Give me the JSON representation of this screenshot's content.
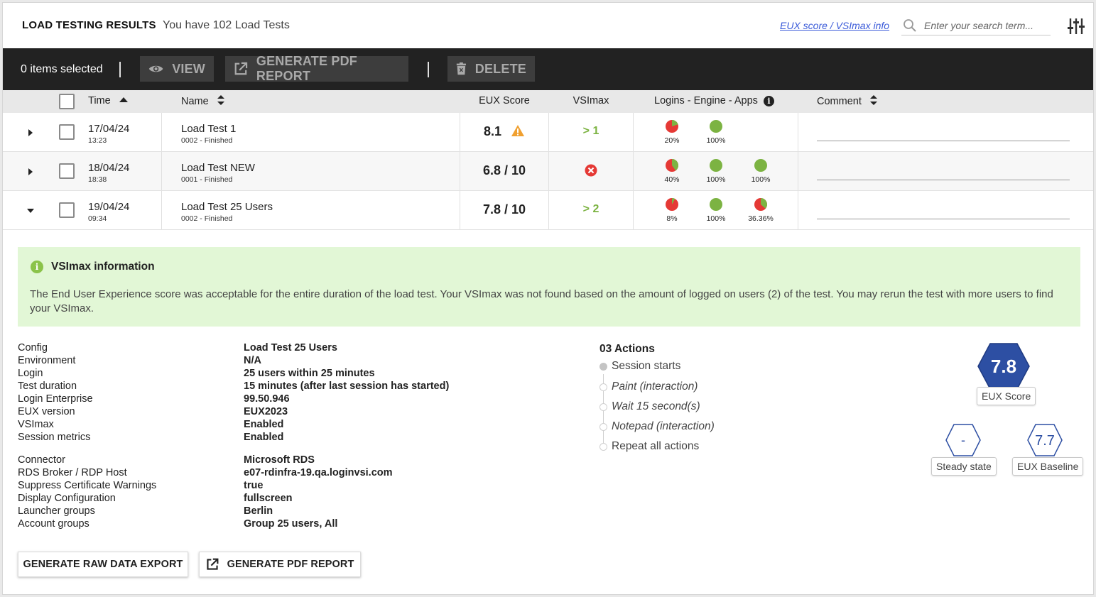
{
  "header": {
    "title": "LOAD TESTING RESULTS",
    "subtitle": "You have 102 Load Tests",
    "info_link": "EUX score / VSImax info",
    "search_placeholder": "Enter your search term..."
  },
  "toolbar": {
    "selected": "0 items selected",
    "view": "VIEW",
    "pdf": "GENERATE PDF REPORT",
    "delete": "DELETE"
  },
  "columns": {
    "time": "Time",
    "name": "Name",
    "eux": "EUX Score",
    "vsimax": "VSImax",
    "lea": "Logins - Engine - Apps",
    "comment": "Comment"
  },
  "rows": [
    {
      "date": "17/04/24",
      "time": "13:23",
      "name": "Load Test 1",
      "status": "0002 - Finished",
      "eux": "8.1",
      "eux_warning": true,
      "vsimax": "> 1",
      "vsimax_error": false,
      "expanded": false,
      "pies": [
        {
          "label": "20%",
          "fraction": 0.2
        },
        {
          "label": "100%",
          "fraction": 1.0
        }
      ]
    },
    {
      "date": "18/04/24",
      "time": "18:38",
      "name": "Load Test NEW",
      "status": "0001 - Finished",
      "eux": "6.8 / 10",
      "eux_warning": false,
      "vsimax": "",
      "vsimax_error": true,
      "expanded": false,
      "pies": [
        {
          "label": "40%",
          "fraction": 0.4
        },
        {
          "label": "100%",
          "fraction": 1.0
        },
        {
          "label": "100%",
          "fraction": 1.0
        }
      ]
    },
    {
      "date": "19/04/24",
      "time": "09:34",
      "name": "Load Test 25 Users",
      "status": "0002 - Finished",
      "eux": "7.8 / 10",
      "eux_warning": false,
      "vsimax": "> 2",
      "vsimax_error": false,
      "expanded": true,
      "pies": [
        {
          "label": "8%",
          "fraction": 0.08
        },
        {
          "label": "100%",
          "fraction": 1.0
        },
        {
          "label": "36.36%",
          "fraction": 0.3636
        }
      ]
    }
  ],
  "banner": {
    "title": "VSImax information",
    "text": "The End User Experience score was acceptable for the entire duration of the load test. Your VSImax was not found based on the amount of logged on users (2) of the test. You may rerun the test with more users to find your VSImax."
  },
  "details": {
    "group1": [
      {
        "key": "Config",
        "value": "Load Test 25 Users"
      },
      {
        "key": "Environment",
        "value": "N/A"
      },
      {
        "key": "Login",
        "value": "25 users within 25 minutes"
      },
      {
        "key": "Test duration",
        "value": "15 minutes (after last session has started)"
      },
      {
        "key": "Login Enterprise",
        "value": "99.50.946"
      },
      {
        "key": "EUX version",
        "value": "EUX2023"
      },
      {
        "key": "VSImax",
        "value": "Enabled"
      },
      {
        "key": "Session metrics",
        "value": "Enabled"
      }
    ],
    "group2": [
      {
        "key": "Connector",
        "value": "Microsoft RDS"
      },
      {
        "key": "RDS Broker / RDP Host",
        "value": "e07-rdinfra-19.qa.loginvsi.com"
      },
      {
        "key": "Suppress Certificate Warnings",
        "value": "true"
      },
      {
        "key": "Display Configuration",
        "value": "fullscreen"
      },
      {
        "key": "Launcher groups",
        "value": "Berlin"
      },
      {
        "key": "Account groups",
        "value": "Group 25 users, All"
      }
    ]
  },
  "actions": {
    "title": "03 Actions",
    "items": [
      {
        "label": "Session starts",
        "italic": false,
        "filled": true
      },
      {
        "label": "Paint (interaction)",
        "italic": true,
        "filled": false
      },
      {
        "label": "Wait 15 second(s)",
        "italic": true,
        "filled": false
      },
      {
        "label": "Notepad (interaction)",
        "italic": true,
        "filled": false
      },
      {
        "label": "Repeat all actions",
        "italic": false,
        "filled": false
      }
    ]
  },
  "scores": {
    "eux_value": "7.8",
    "eux_label": "EUX Score",
    "steady_value": "-",
    "steady_label": "Steady state",
    "baseline_value": "7.7",
    "baseline_label": "EUX Baseline"
  },
  "buttons": {
    "raw_export": "GENERATE RAW DATA EXPORT",
    "pdf_report": "GENERATE PDF REPORT"
  },
  "colors": {
    "accent_blue": "#2d4fa3",
    "green": "#7cb342",
    "red": "#e53935",
    "warning": "#f0a030",
    "banner_bg": "#e2f7d6"
  }
}
